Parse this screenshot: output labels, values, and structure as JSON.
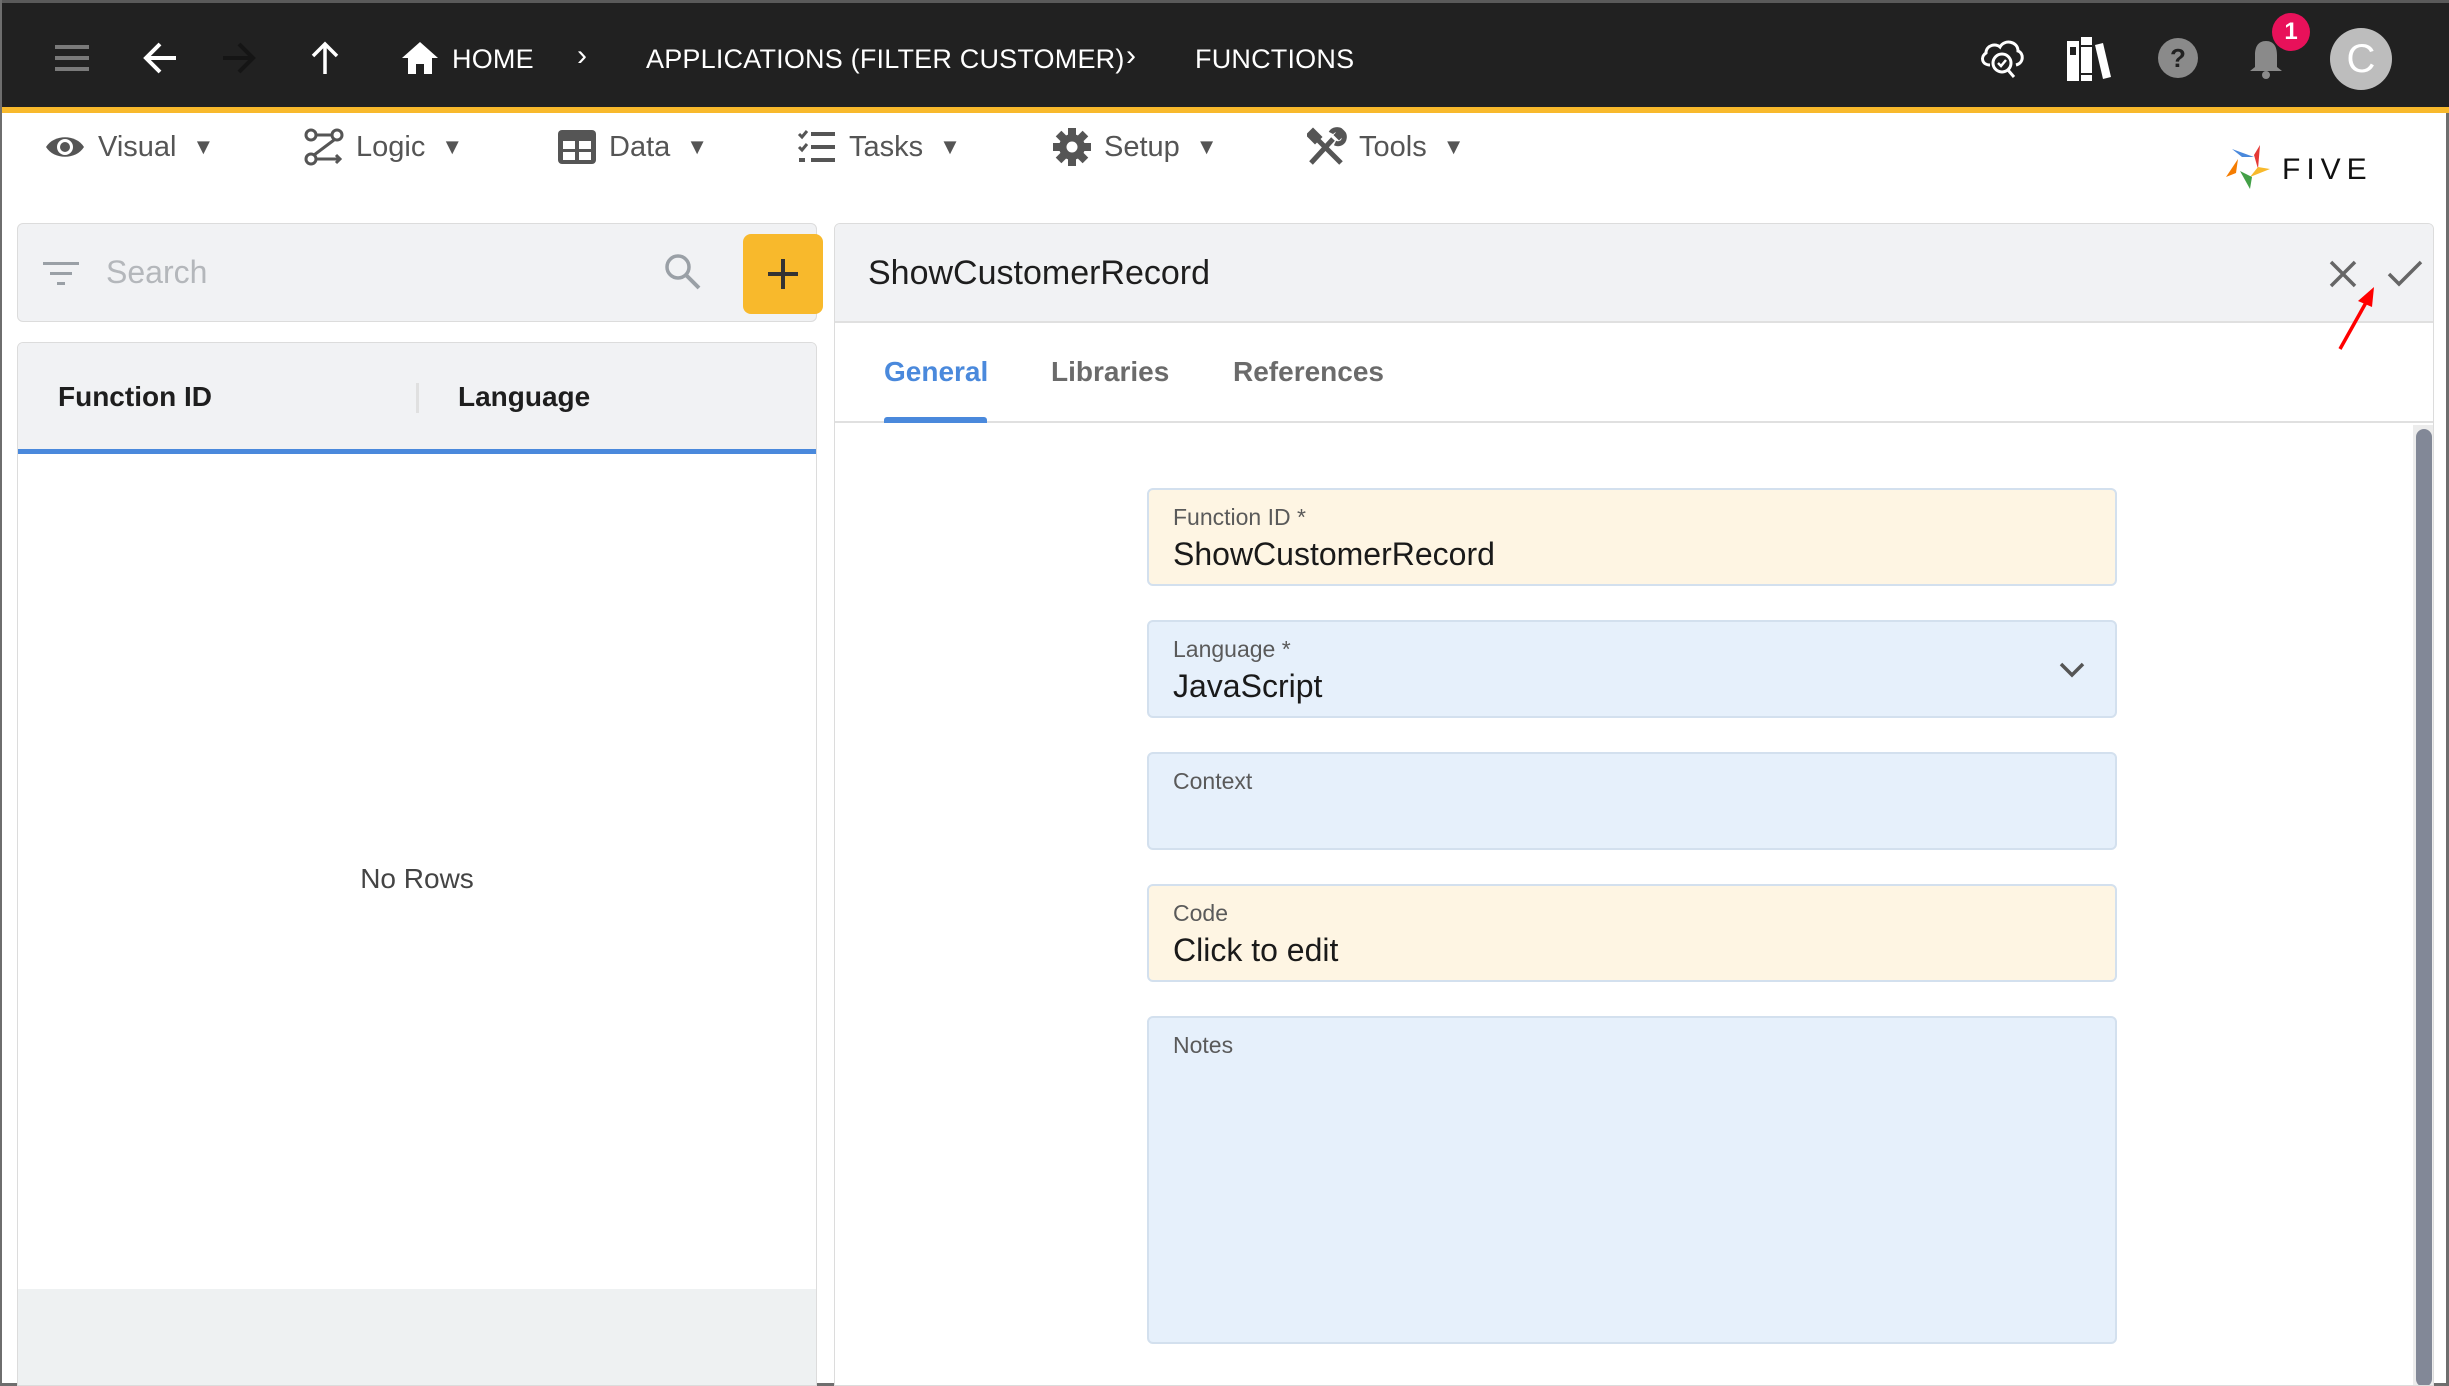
{
  "header": {
    "icons": {
      "menu": "hamburger-menu-icon",
      "back": "arrow-left-icon",
      "forward": "arrow-right-icon",
      "up": "arrow-up-icon",
      "home": "home-icon"
    },
    "breadcrumb": [
      {
        "label": "HOME"
      },
      {
        "label": "APPLICATIONS (FILTER CUSTOMER)"
      },
      {
        "label": "FUNCTIONS"
      }
    ],
    "separator": "›",
    "right_icons": [
      "cloud-search-check-icon",
      "library-books-icon",
      "help-icon",
      "notification-bell-icon"
    ],
    "notification_count": "1",
    "avatar_initial": "C"
  },
  "menu": {
    "items": [
      {
        "label": "Visual",
        "icon": "eye-icon"
      },
      {
        "label": "Logic",
        "icon": "logic-flow-icon"
      },
      {
        "label": "Data",
        "icon": "table-grid-icon"
      },
      {
        "label": "Tasks",
        "icon": "checklist-icon"
      },
      {
        "label": "Setup",
        "icon": "gear-icon"
      },
      {
        "label": "Tools",
        "icon": "wrench-screwdriver-icon"
      }
    ],
    "caret": "▼",
    "logo_text": "FIVE"
  },
  "left_panel": {
    "search": {
      "placeholder": "Search"
    },
    "add_button": "+",
    "columns": [
      "Function ID",
      "Language"
    ],
    "empty_message": "No Rows"
  },
  "right_panel": {
    "title": "ShowCustomerRecord",
    "tabs": [
      {
        "label": "General",
        "active": true
      },
      {
        "label": "Libraries",
        "active": false
      },
      {
        "label": "References",
        "active": false
      }
    ],
    "fields": {
      "function_id": {
        "label": "Function ID *",
        "value": "ShowCustomerRecord"
      },
      "language": {
        "label": "Language *",
        "value": "JavaScript"
      },
      "context": {
        "label": "Context",
        "value": ""
      },
      "code": {
        "label": "Code",
        "value": "Click to edit"
      },
      "notes": {
        "label": "Notes",
        "value": ""
      }
    }
  },
  "colors": {
    "header_bg": "#212121",
    "accent_yellow": "#F8B92C",
    "accent_blue": "#4A89DC",
    "badge_red": "#E8115A",
    "required_field_bg": "#fef5e3",
    "optional_field_bg": "#e6f0fb",
    "annotation_arrow": "#ff0000"
  }
}
